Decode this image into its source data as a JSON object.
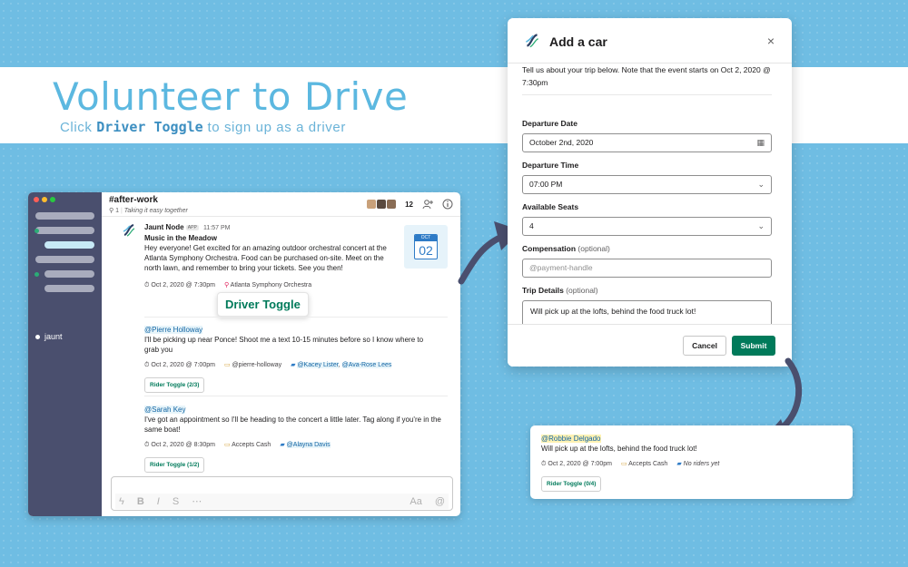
{
  "hero": {
    "title": "Volunteer to Drive",
    "subtitle_pre": "Click",
    "subtitle_code": "Driver Toggle",
    "subtitle_post": "to sign up as a driver"
  },
  "colors": {
    "background": "#6fbde3",
    "accent": "#5cb8e0",
    "primary_green": "#007a5a",
    "sidebar": "#4a4f6e",
    "link_blue": "#1264a3"
  },
  "sidebar": {
    "workspace_label": "jaunt"
  },
  "channel": {
    "name": "#after-work",
    "pins": "1",
    "topic": "Taking it easy together",
    "member_count": "12"
  },
  "message": {
    "sender": "Jaunt Node",
    "badge": "APP",
    "time": "11:57 PM",
    "title": "Music in the Meadow",
    "body": "Hey everyone! Get excited for an amazing outdoor orchestral concert at the Atlanta Symphony Orchestra. Food can be purchased on-site. Meet on the north lawn, and remember to bring your tickets. See you then!",
    "when": "Oct 2, 2020 @ 7:30pm",
    "where": "Atlanta Symphony Orchestra",
    "calendar_month": "OCT",
    "calendar_day": "02",
    "driver_toggle_label": "Driver Toggle"
  },
  "drivers": [
    {
      "mention": "@Pierre Holloway",
      "text": "I'll be picking up near Ponce! Shoot me a text 10-15 minutes before so I know where to grab you",
      "when": "Oct 2, 2020 @ 7:00pm",
      "payment": "@pierre-holloway",
      "rider_1": "@Kacey Lister",
      "rider_2": "@Ava-Rose Lees",
      "toggle": "Rider Toggle (2/3)"
    },
    {
      "mention": "@Sarah Key",
      "text": "I've got an appointment so I'll be heading to the concert a little later. Tag along if you're in the same boat!",
      "when": "Oct 2, 2020 @ 8:30pm",
      "payment": "Accepts Cash",
      "rider_1": "@Alayna Davis",
      "toggle": "Rider Toggle (1/2)"
    }
  ],
  "composer": {
    "tools": [
      "ϟ",
      "B",
      "I",
      "S",
      "⋯",
      "Aa",
      "@"
    ]
  },
  "modal": {
    "title": "Add a car",
    "close": "×",
    "intro": "Tell us about your trip below. Note that the event starts on Oct 2, 2020 @ 7:30pm",
    "departure_date_label": "Departure Date",
    "departure_date_value": "October 2nd, 2020",
    "departure_time_label": "Departure Time",
    "departure_time_value": "07:00 PM",
    "seats_label": "Available Seats",
    "seats_value": "4",
    "compensation_label": "Compensation",
    "compensation_optional": "(optional)",
    "compensation_placeholder": "@payment-handle",
    "trip_details_label": "Trip Details",
    "trip_details_optional": "(optional)",
    "trip_details_value": "Will pick up at the lofts, behind the food truck lot!",
    "cancel": "Cancel",
    "submit": "Submit"
  },
  "result": {
    "mention": "@Robbie Delgado",
    "text": "Will pick up at the lofts, behind the food truck lot!",
    "when": "Oct 2, 2020 @ 7:00pm",
    "payment": "Accepts Cash",
    "riders": "No riders yet",
    "toggle": "Rider Toggle (0/4)"
  }
}
